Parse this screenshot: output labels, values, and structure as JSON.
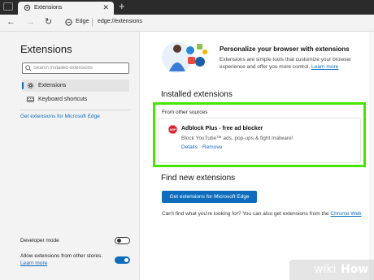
{
  "tab": {
    "title": "Extensions",
    "close_glyph": "✕"
  },
  "new_tab_glyph": "+",
  "address_bar": {
    "back_glyph": "←",
    "forward_glyph": "→",
    "refresh_glyph": "↻",
    "browser_label": "Edge",
    "url": "edge://extensions"
  },
  "sidebar": {
    "title": "Extensions",
    "search_placeholder": "Search installed extensions",
    "items": [
      {
        "label": "Extensions",
        "icon": "gear-icon",
        "active": true
      },
      {
        "label": "Keyboard shortcuts",
        "icon": "keyboard-icon",
        "active": false
      }
    ],
    "get_link": "Get extensions for Microsoft Edge",
    "developer_mode": {
      "label": "Developer mode",
      "on": false
    },
    "allow_other": {
      "label": "Allow extensions from other stores.",
      "learn_more": "Learn more",
      "on": true
    }
  },
  "promo": {
    "title": "Personalize your browser with extensions",
    "body": "Extensions are simple tools that customize your browser experience and offer you more control.",
    "learn_more": "Learn more"
  },
  "installed": {
    "title": "Installed extensions",
    "group": "From other sources",
    "extension": {
      "name": "Adblock Plus - free ad blocker",
      "description": "Block YouTube™ ads, pop-ups & fight malware!",
      "details": "Details",
      "remove": "Remove",
      "icon_text": "ABP"
    }
  },
  "find": {
    "title": "Find new extensions",
    "button": "Get extensions for Microsoft Edge",
    "text": "Can't find what you're looking for? You can also get extensions from the",
    "link": "Chrome Web"
  },
  "colors": {
    "accent": "#0f6cbd",
    "highlight": "#46e600",
    "abp_red": "#d9232e"
  },
  "watermark": {
    "part1": "wiki",
    "part2": "How"
  }
}
